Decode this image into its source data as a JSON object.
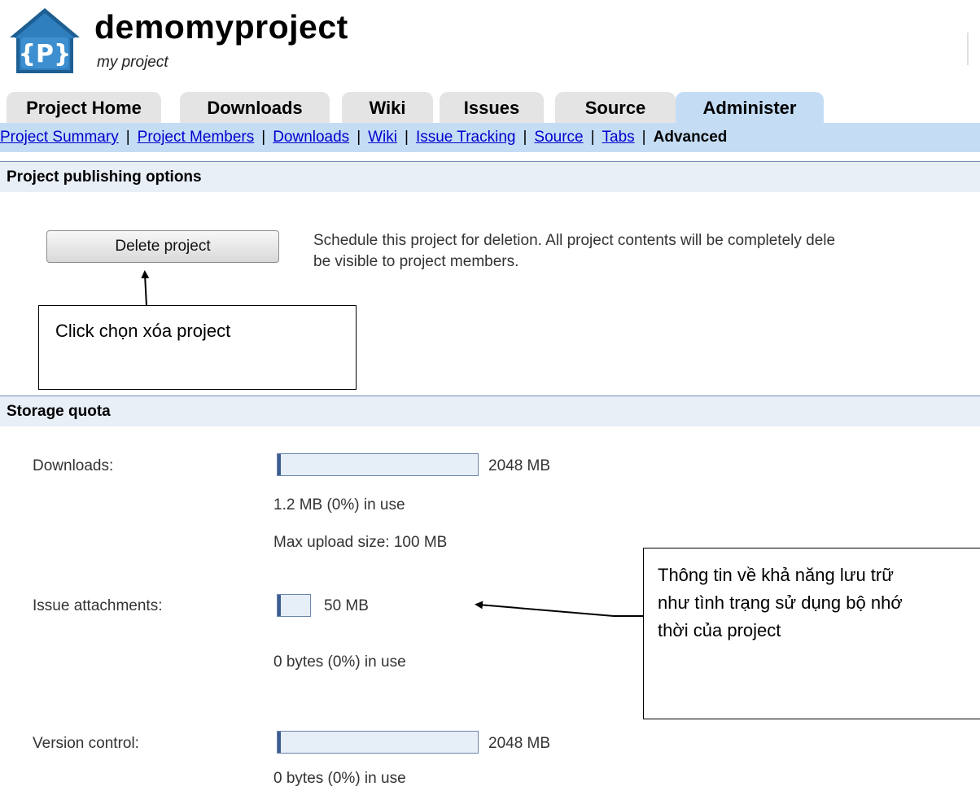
{
  "project": {
    "name": "demomyproject",
    "subtitle": "my project",
    "logo_text": "{P}"
  },
  "tabs": [
    {
      "label": "Project Home",
      "active": false
    },
    {
      "label": "Downloads",
      "active": false
    },
    {
      "label": "Wiki",
      "active": false
    },
    {
      "label": "Issues",
      "active": false
    },
    {
      "label": "Source",
      "active": false
    },
    {
      "label": "Administer",
      "active": true
    }
  ],
  "subnav": {
    "links": [
      "Project Summary",
      "Project Members",
      "Downloads",
      "Wiki",
      "Issue Tracking",
      "Source",
      "Tabs"
    ],
    "current": "Advanced",
    "separator": "|"
  },
  "publishing": {
    "title": "Project publishing options",
    "delete_button": "Delete project",
    "description_line1": "Schedule this project for deletion. All project contents will be completely dele",
    "description_line2": "be visible to project members."
  },
  "annotation_delete": "Click chọn xóa project",
  "storage": {
    "title": "Storage quota",
    "downloads": {
      "label": "Downloads:",
      "capacity": "2048 MB",
      "usage": "1.2 MB (0%) in use",
      "max_upload": "Max upload size: 100 MB",
      "fill_fraction": 0.0
    },
    "issue_attachments": {
      "label": "Issue attachments:",
      "capacity": "50 MB",
      "usage": "0 bytes (0%) in use",
      "fill_fraction": 0.0
    },
    "version_control": {
      "label": "Version control:",
      "capacity": "2048 MB",
      "usage": "0 bytes (0%) in use",
      "fill_fraction": 0.0
    }
  },
  "annotation_storage": {
    "line1": "Thông tin về khả năng lưu trữ",
    "line2": "như tình trạng sử dụng bộ nhớ",
    "line3": "thời của project"
  },
  "colors": {
    "tab_active": "#c4ddf5",
    "tab_inactive": "#e4e4e4",
    "section_bg": "#e9eff7",
    "link": "#0000cc",
    "bar_fill": "#3b5c92"
  }
}
